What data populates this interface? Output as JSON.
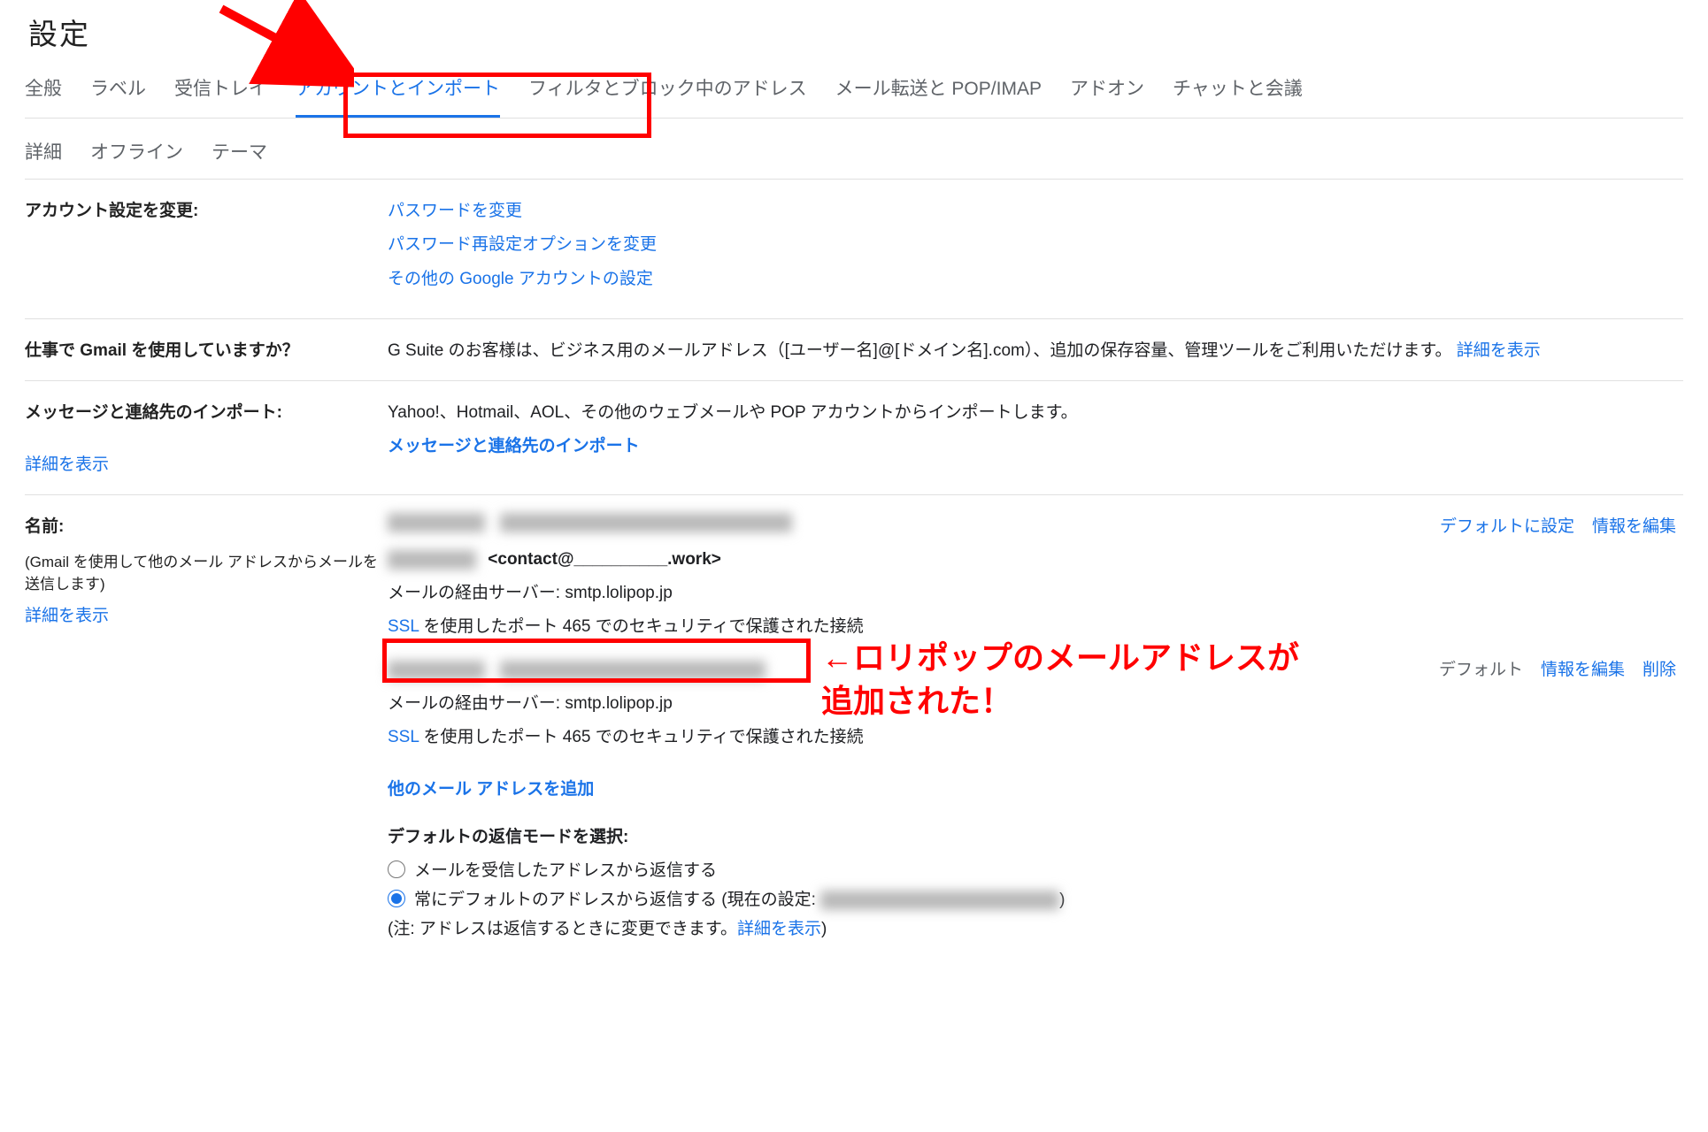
{
  "title": "設定",
  "tabs_row1": [
    {
      "label": "全般"
    },
    {
      "label": "ラベル"
    },
    {
      "label": "受信トレイ"
    },
    {
      "label": "アカウントとインポート"
    },
    {
      "label": "フィルタとブロック中のアドレス"
    },
    {
      "label": "メール転送と POP/IMAP"
    },
    {
      "label": "アドオン"
    },
    {
      "label": "チャットと会議"
    }
  ],
  "tabs_row2": [
    {
      "label": "詳細"
    },
    {
      "label": "オフライン"
    },
    {
      "label": "テーマ"
    }
  ],
  "account_settings": {
    "label": "アカウント設定を変更:",
    "links": {
      "change_password": "パスワードを変更",
      "change_recovery": "パスワード再設定オプションを変更",
      "other_google": "その他の Google アカウントの設定"
    }
  },
  "gsuite": {
    "label": "仕事で Gmail を使用していますか？",
    "desc_pre": "G Suite のお客様は、ビジネス用のメールアドレス（[ユーザー名]@[ドメイン名].com）、追加の保存容量、管理ツールをご利用いただけます。",
    "learn_more": "詳細を表示"
  },
  "import": {
    "label": "メッセージと連絡先のインポート:",
    "desc": "Yahoo!、Hotmail、AOL、その他のウェブメールや POP アカウントからインポートします。",
    "link": "メッセージと連絡先のインポート",
    "learn_more": "詳細を表示"
  },
  "names": {
    "label": "名前:",
    "sub": "(Gmail を使用して他のメール アドレスからメールを送信します)",
    "learn_more": "詳細を表示",
    "row1": {
      "set_default": "デフォルトに設定",
      "edit": "情報を編集"
    },
    "row2": {
      "address_visible": "<contact@__________.work>",
      "server": "メールの経由サーバー: smtp.lolipop.jp",
      "ssl_prefix": "SSL",
      "ssl_rest": " を使用したポート 465 でのセキュリティで保護された接続"
    },
    "row3": {
      "default_label": "デフォルト",
      "edit": "情報を編集",
      "delete": "削除",
      "server": "メールの経由サーバー: smtp.lolipop.jp",
      "ssl_prefix": "SSL",
      "ssl_rest": " を使用したポート 465 でのセキュリティで保護された接続"
    },
    "add_another": "他のメール アドレスを追加",
    "reply_mode_label": "デフォルトの返信モードを選択:",
    "reply_opt1": "メールを受信したアドレスから返信する",
    "reply_opt2_pre": "常にデフォルトのアドレスから返信する (現在の設定: ",
    "reply_opt2_post": ")",
    "note_pre": "(注: アドレスは返信するときに変更できます。",
    "note_link": "詳細を表示",
    "note_post": ")"
  },
  "annotation": {
    "text": "←ロリポップのメールアドレスが\n追加された！"
  }
}
